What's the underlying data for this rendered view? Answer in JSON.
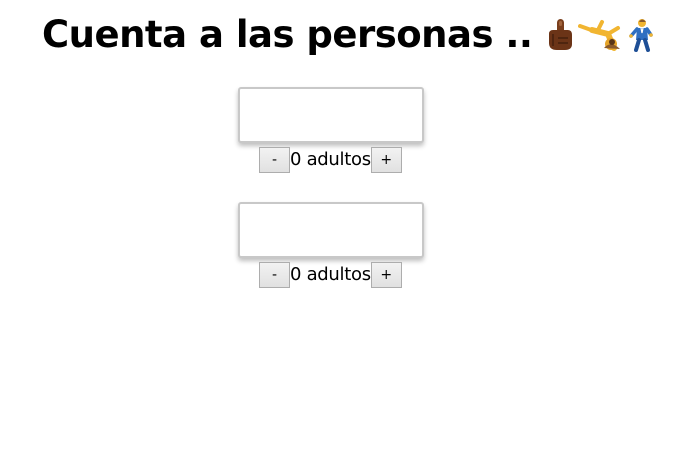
{
  "title": {
    "text": "Cuenta a las personas ..",
    "icons": [
      "pointing-up-finger-icon",
      "acrobat-cartwheel-icon",
      "person-walking-icon"
    ]
  },
  "counters": [
    {
      "display_value": "",
      "decrement_label": "-",
      "count_text": "0 adultos",
      "increment_label": "+"
    },
    {
      "display_value": "",
      "decrement_label": "-",
      "count_text": "0 adultos",
      "increment_label": "+"
    }
  ]
}
